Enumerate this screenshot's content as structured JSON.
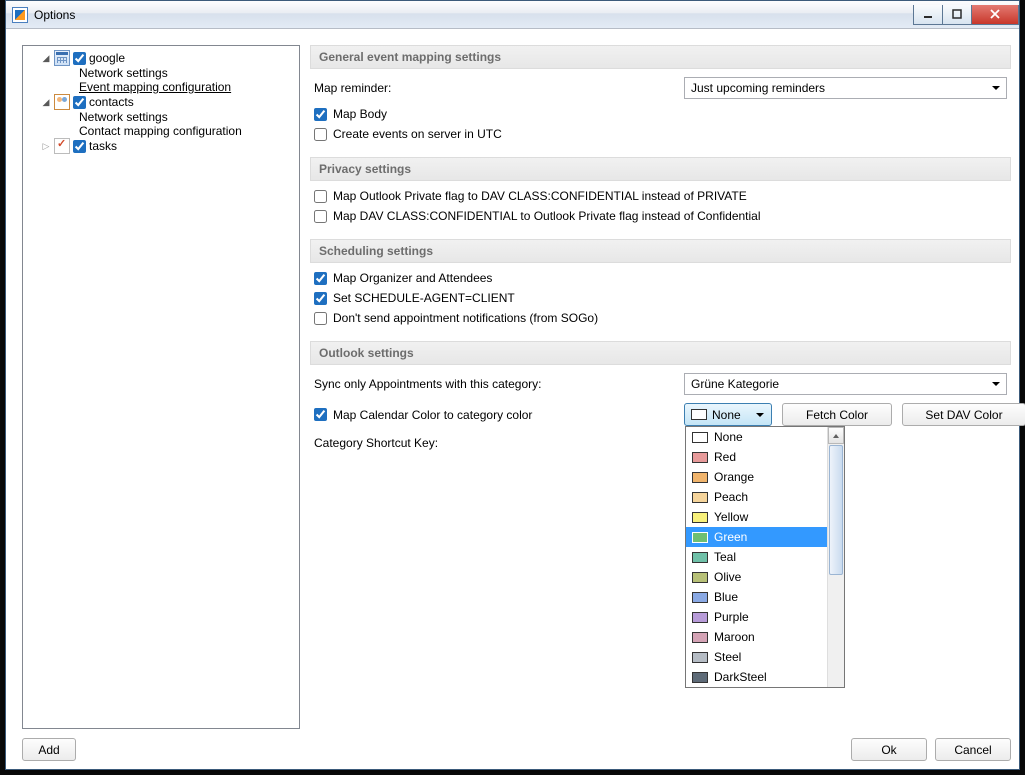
{
  "window_title": "Options",
  "tree": {
    "nodes": [
      {
        "label": "google",
        "checked": true,
        "icon": "cal",
        "expanded": true,
        "children": [
          "Network settings",
          "Event mapping configuration"
        ],
        "selected_child": 1
      },
      {
        "label": "contacts",
        "checked": true,
        "icon": "con",
        "expanded": true,
        "children": [
          "Network settings",
          "Contact mapping configuration"
        ]
      },
      {
        "label": "tasks",
        "checked": true,
        "icon": "task",
        "expanded": false,
        "children": []
      }
    ]
  },
  "add_button": "Add",
  "sections": {
    "general": {
      "title": "General event mapping settings",
      "map_reminder_label": "Map reminder:",
      "map_reminder_value": "Just upcoming reminders",
      "map_body": {
        "label": "Map Body",
        "checked": true
      },
      "create_utc": {
        "label": "Create events on server in UTC",
        "checked": false
      }
    },
    "privacy": {
      "title": "Privacy settings",
      "opt1": {
        "label": "Map Outlook Private flag to DAV CLASS:CONFIDENTIAL instead of PRIVATE",
        "checked": false
      },
      "opt2": {
        "label": "Map DAV CLASS:CONFIDENTIAL to Outlook Private flag instead of Confidential",
        "checked": false
      }
    },
    "scheduling": {
      "title": "Scheduling settings",
      "org": {
        "label": "Map Organizer and Attendees",
        "checked": true
      },
      "agent": {
        "label": "Set SCHEDULE-AGENT=CLIENT",
        "checked": true
      },
      "notif": {
        "label": "Don't send appointment notifications (from SOGo)",
        "checked": false
      }
    },
    "outlook": {
      "title": "Outlook settings",
      "sync_cat_label": "Sync only Appointments with this category:",
      "sync_cat_value": "Grüne Kategorie",
      "map_color": {
        "label": "Map Calendar Color to category color",
        "checked": true
      },
      "color_dd_value": "None",
      "fetch_btn": "Fetch Color",
      "setdav_btn": "Set DAV Color",
      "shortcut_label": "Category Shortcut Key:"
    }
  },
  "colors": [
    {
      "name": "None",
      "hex": "#ffffff"
    },
    {
      "name": "Red",
      "hex": "#e79a9a"
    },
    {
      "name": "Orange",
      "hex": "#f0b46c"
    },
    {
      "name": "Peach",
      "hex": "#f5d49b"
    },
    {
      "name": "Yellow",
      "hex": "#f7f07a"
    },
    {
      "name": "Green",
      "hex": "#6fbf73",
      "selected": true
    },
    {
      "name": "Teal",
      "hex": "#6fc0a8"
    },
    {
      "name": "Olive",
      "hex": "#b7c077"
    },
    {
      "name": "Blue",
      "hex": "#8aa9e4"
    },
    {
      "name": "Purple",
      "hex": "#b79bd8"
    },
    {
      "name": "Maroon",
      "hex": "#d4a3b5"
    },
    {
      "name": "Steel",
      "hex": "#b5bcc4"
    },
    {
      "name": "DarkSteel",
      "hex": "#5e6b78"
    }
  ],
  "buttons": {
    "ok": "Ok",
    "cancel": "Cancel"
  }
}
